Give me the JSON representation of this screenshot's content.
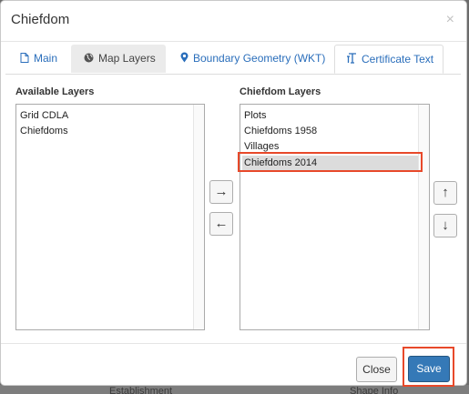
{
  "backdrop": {
    "left_text": "Establishment",
    "right_text": "Shape Info"
  },
  "dialog": {
    "title": "Chiefdom",
    "close_glyph": "×"
  },
  "tabs": [
    {
      "label": "Main",
      "icon": "file-icon",
      "glyph": "🗋"
    },
    {
      "label": "Map Layers",
      "icon": "globe-icon",
      "glyph": "🌍"
    },
    {
      "label": "Boundary Geometry (WKT)",
      "icon": "map-marker-icon",
      "glyph": "📍"
    },
    {
      "label": "Certificate Text",
      "icon": "text-format-icon",
      "glyph": "T"
    }
  ],
  "available": {
    "label": "Available Layers",
    "items": [
      "Grid CDLA",
      "Chiefdoms"
    ]
  },
  "chiefdom_layers": {
    "label": "Chiefdom Layers",
    "items": [
      "Plots",
      "Chiefdoms 1958",
      "Villages",
      "Chiefdoms 2014"
    ],
    "selected": "Chiefdoms 2014"
  },
  "controls": {
    "move_right": "→",
    "move_left": "←",
    "move_up": "↑",
    "move_down": "↓"
  },
  "footer": {
    "close_label": "Close",
    "save_label": "Save"
  },
  "colors": {
    "accent": "#3579b7",
    "link": "#2a6ebb",
    "highlight": "#e8492a"
  }
}
